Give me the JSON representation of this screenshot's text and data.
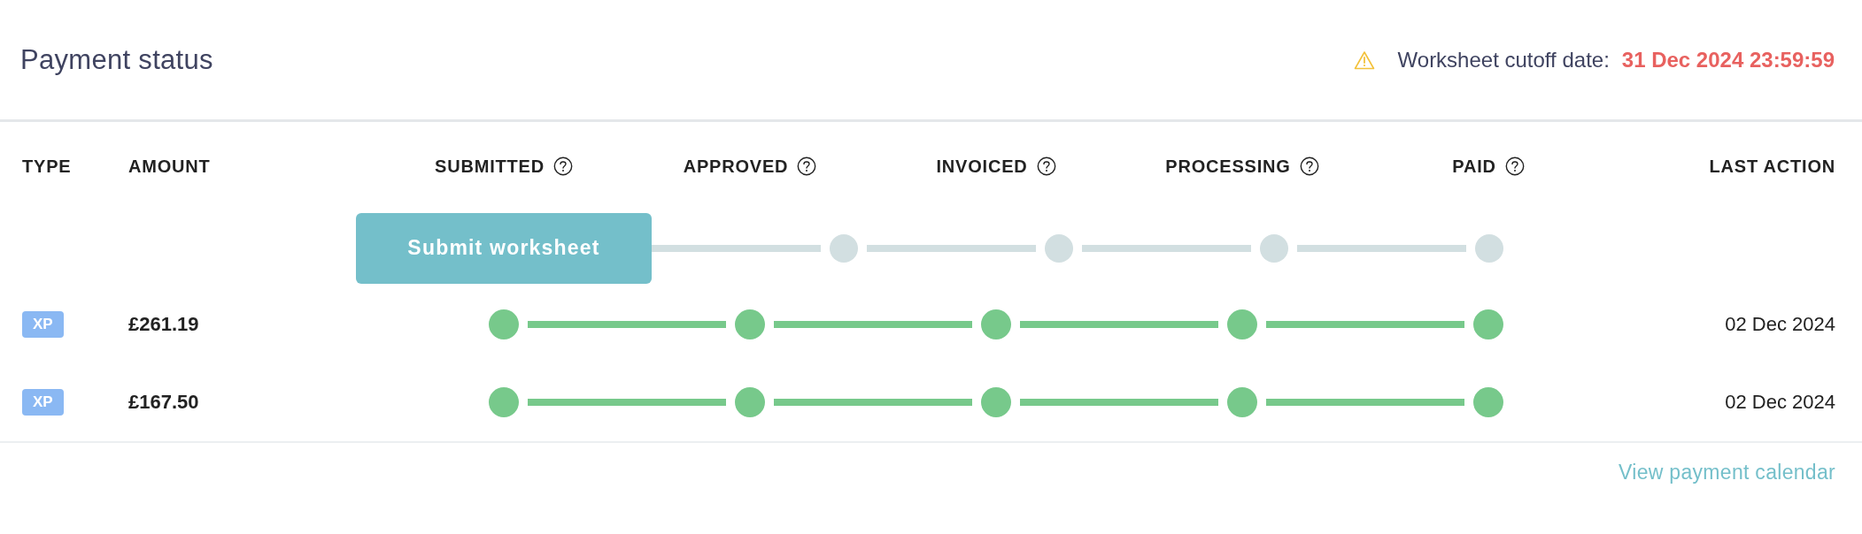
{
  "title": "Payment status",
  "cutoff": {
    "label": "Worksheet cutoff date:",
    "value": "31 Dec 2024 23:59:59"
  },
  "table": {
    "columns": [
      {
        "label": "TYPE",
        "help": false
      },
      {
        "label": "AMOUNT",
        "help": false
      },
      {
        "label": "SUBMITTED",
        "help": true
      },
      {
        "label": "APPROVED",
        "help": true
      },
      {
        "label": "INVOICED",
        "help": true
      },
      {
        "label": "PROCESSING",
        "help": true
      },
      {
        "label": "PAID",
        "help": true
      },
      {
        "label": "LAST ACTION",
        "help": false
      }
    ],
    "rows": [
      {
        "button": "Submit worksheet",
        "stages": [
          {
            "done": false
          },
          {
            "done": false
          },
          {
            "done": false
          },
          {
            "done": false
          }
        ]
      },
      {
        "type": "XP",
        "amount": "£261.19",
        "stages": [
          {
            "done": true
          },
          {
            "done": true
          },
          {
            "done": true
          },
          {
            "done": true
          },
          {
            "done": true
          }
        ],
        "last_action": "02 Dec 2024"
      },
      {
        "type": "XP",
        "amount": "£167.50",
        "stages": [
          {
            "done": true
          },
          {
            "done": true
          },
          {
            "done": true
          },
          {
            "done": true
          },
          {
            "done": true
          }
        ],
        "last_action": "02 Dec 2024"
      }
    ]
  },
  "link": "View payment calendar"
}
